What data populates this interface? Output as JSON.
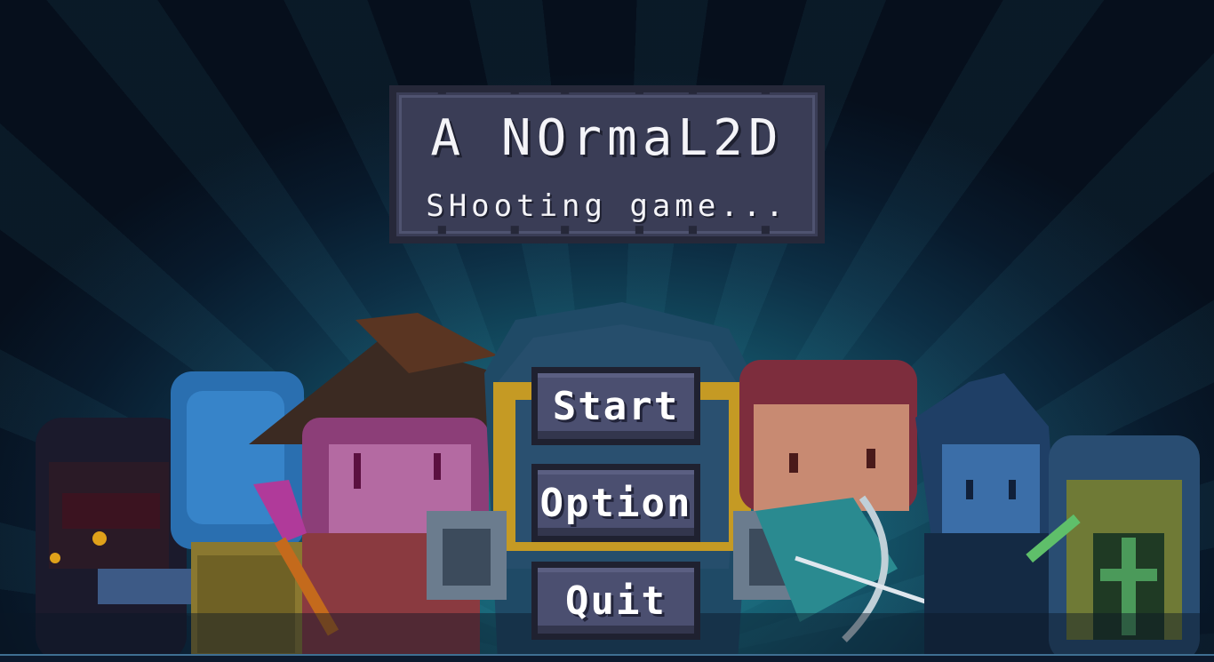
{
  "title": {
    "line1": "A NOrmaL2D",
    "line2": "SHooting game..."
  },
  "menu": {
    "start_label": "Start",
    "option_label": "Option",
    "quit_label": "Quit"
  },
  "colors": {
    "panel": "#3a3d56",
    "button": "#4b4f70",
    "background": "#07101e",
    "glow": "#1e7f8c"
  }
}
